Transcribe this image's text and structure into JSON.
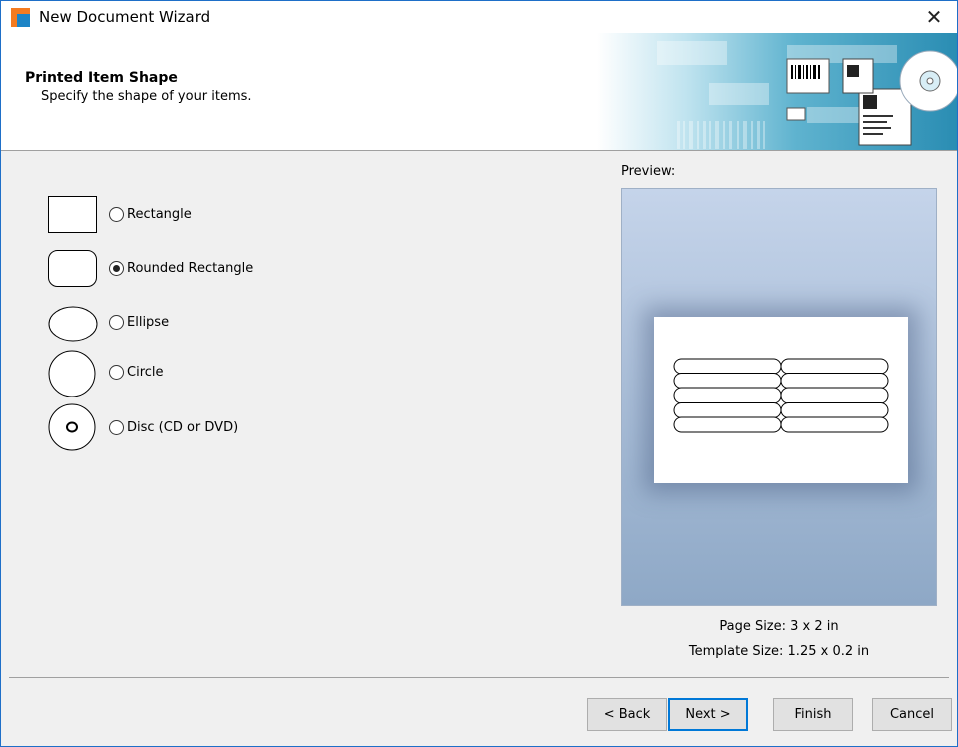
{
  "window": {
    "title": "New Document Wizard",
    "close_glyph": "✕"
  },
  "header": {
    "title": "Printed Item Shape",
    "subtitle": "Specify the shape of your items."
  },
  "shapes": {
    "options": [
      {
        "label": "Rectangle",
        "selected": false,
        "icon": "rectangle-shape-icon"
      },
      {
        "label": "Rounded Rectangle",
        "selected": true,
        "icon": "rounded-rectangle-shape-icon"
      },
      {
        "label": "Ellipse",
        "selected": false,
        "icon": "ellipse-shape-icon"
      },
      {
        "label": "Circle",
        "selected": false,
        "icon": "circle-shape-icon"
      },
      {
        "label": "Disc (CD or DVD)",
        "selected": false,
        "icon": "disc-shape-icon"
      }
    ]
  },
  "preview": {
    "label": "Preview:",
    "page_size": "Page Size:  3 x 2 in",
    "template_size": "Template Size:  1.25 x 0.2 in",
    "columns": 2,
    "rows": 5
  },
  "buttons": {
    "back": "< Back",
    "next": "Next >",
    "finish": "Finish",
    "cancel": "Cancel"
  },
  "colors": {
    "accent": "#0078d7",
    "app_icon_orange": "#f47b20",
    "app_icon_blue": "#1c84c6"
  }
}
